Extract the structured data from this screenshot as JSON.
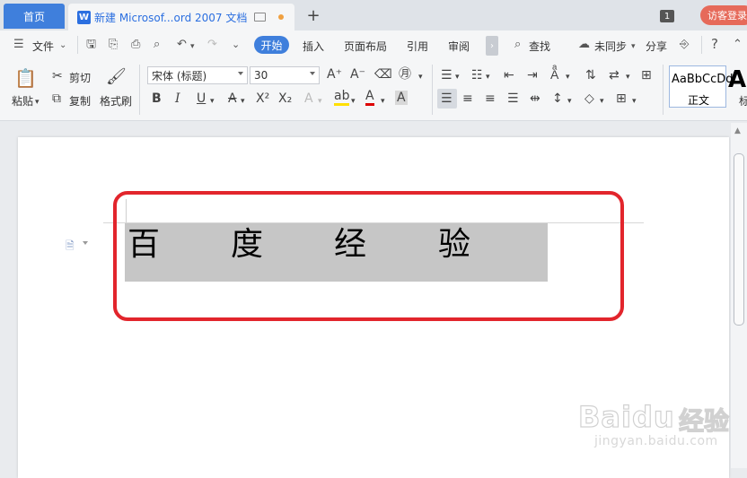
{
  "tabs": {
    "home": "首页",
    "doc_title": "新建 Microsof...ord 2007 文档",
    "doc_icon_letter": "W",
    "new_tab": "+"
  },
  "titlebar_right": {
    "window_count": "1",
    "guest_login": "访客登录"
  },
  "menu": {
    "file": "文件",
    "start": "开始",
    "insert": "插入",
    "layout": "页面布局",
    "reference": "引用",
    "review": "审阅",
    "search": "查找",
    "sync": "未同步",
    "share": "分享"
  },
  "ribbon": {
    "paste": "粘贴",
    "cut": "剪切",
    "copy": "复制",
    "format_painter": "格式刷",
    "font_name": "宋体 (标题)",
    "font_size": "30",
    "style_normal_preview": "AaBbCcDd",
    "style_normal_label": "正文",
    "style_heading_preview": "A",
    "style_heading_label": "标"
  },
  "document": {
    "characters": [
      "百",
      "度",
      "经",
      "验"
    ]
  },
  "watermark": {
    "logo": "Baidu",
    "cn": "经验",
    "url": "jingyan.baidu.com"
  },
  "colors": {
    "accent": "#3f7fdc",
    "annotation_red": "#e2252c",
    "selection_gray": "#c6c6c6"
  }
}
